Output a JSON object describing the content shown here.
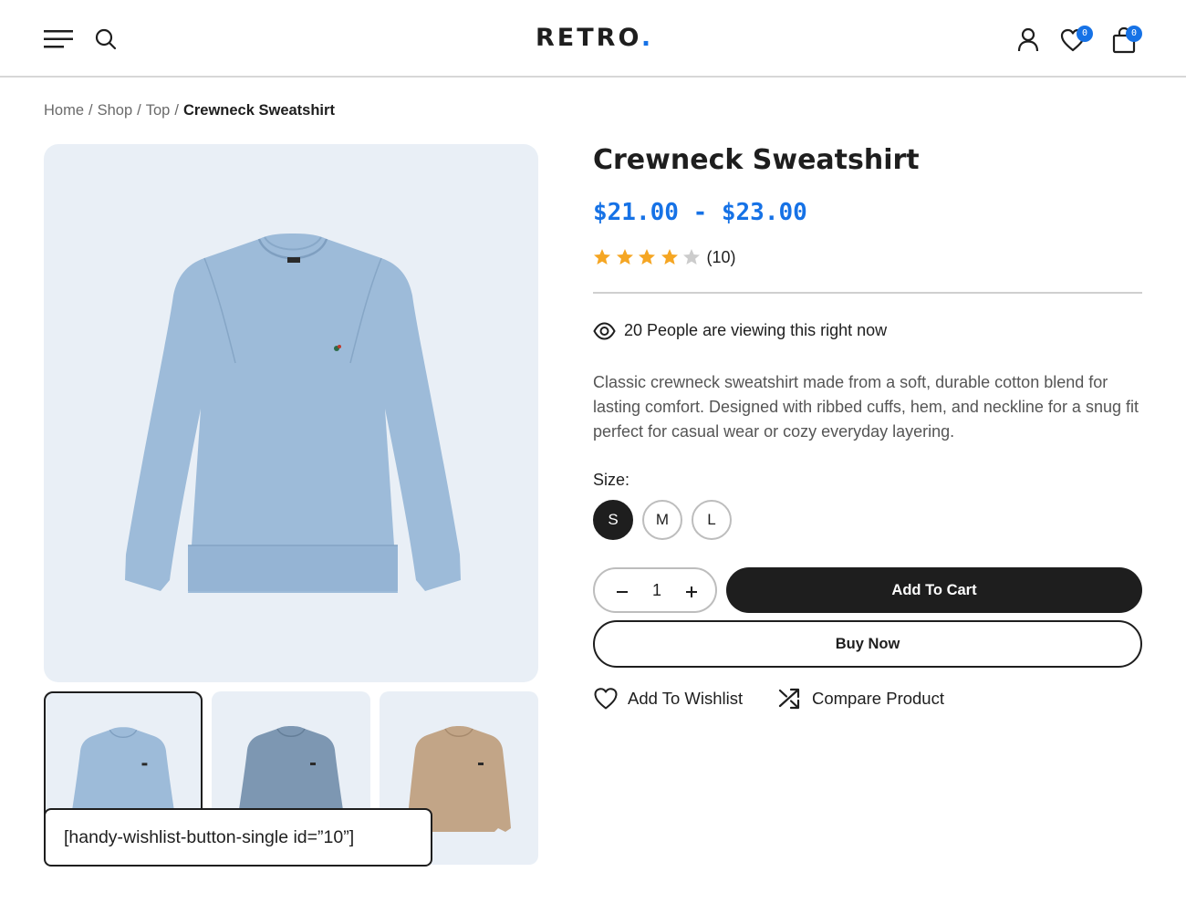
{
  "header": {
    "logo": "RETRO",
    "logo_dot": ".",
    "wishlist_count": "0",
    "cart_count": "0"
  },
  "breadcrumb": [
    {
      "label": "Home"
    },
    {
      "label": "Shop"
    },
    {
      "label": "Top"
    },
    {
      "label": "Crewneck Sweatshirt"
    }
  ],
  "breadcrumb_separator": "/",
  "product": {
    "title": "Crewneck Sweatshirt",
    "price": "$21.00 - $23.00",
    "rating": 4,
    "rating_max": 5,
    "review_count": "(10)",
    "viewing": "20 People are viewing this right now",
    "description": "Classic crewneck sweatshirt made from a soft, durable cotton blend for lasting comfort. Designed with ribbed cuffs, hem, and neckline for a snug fit perfect for casual wear or cozy everyday layering.",
    "size_label": "Size:",
    "sizes": [
      "S",
      "M",
      "L"
    ],
    "selected_size": "S",
    "quantity": "1",
    "add_to_cart": "Add To Cart",
    "buy_now": "Buy Now",
    "wishlist_label": "Add To Wishlist",
    "compare_label": "Compare Product"
  },
  "gallery": {
    "main_color": "#9dbbd9",
    "thumbnails": [
      {
        "color": "#9dbbd9",
        "selected": true
      },
      {
        "color": "#7d97b2",
        "selected": false
      },
      {
        "color": "#c2a587",
        "selected": false
      }
    ]
  },
  "shortcode": "[handy-wishlist-button-single id=”10”]",
  "colors": {
    "accent": "#1672e6",
    "dark": "#1e1e1e",
    "star": "#f5a623",
    "star_empty": "#cccccc",
    "image_bg": "#e9eff6"
  }
}
